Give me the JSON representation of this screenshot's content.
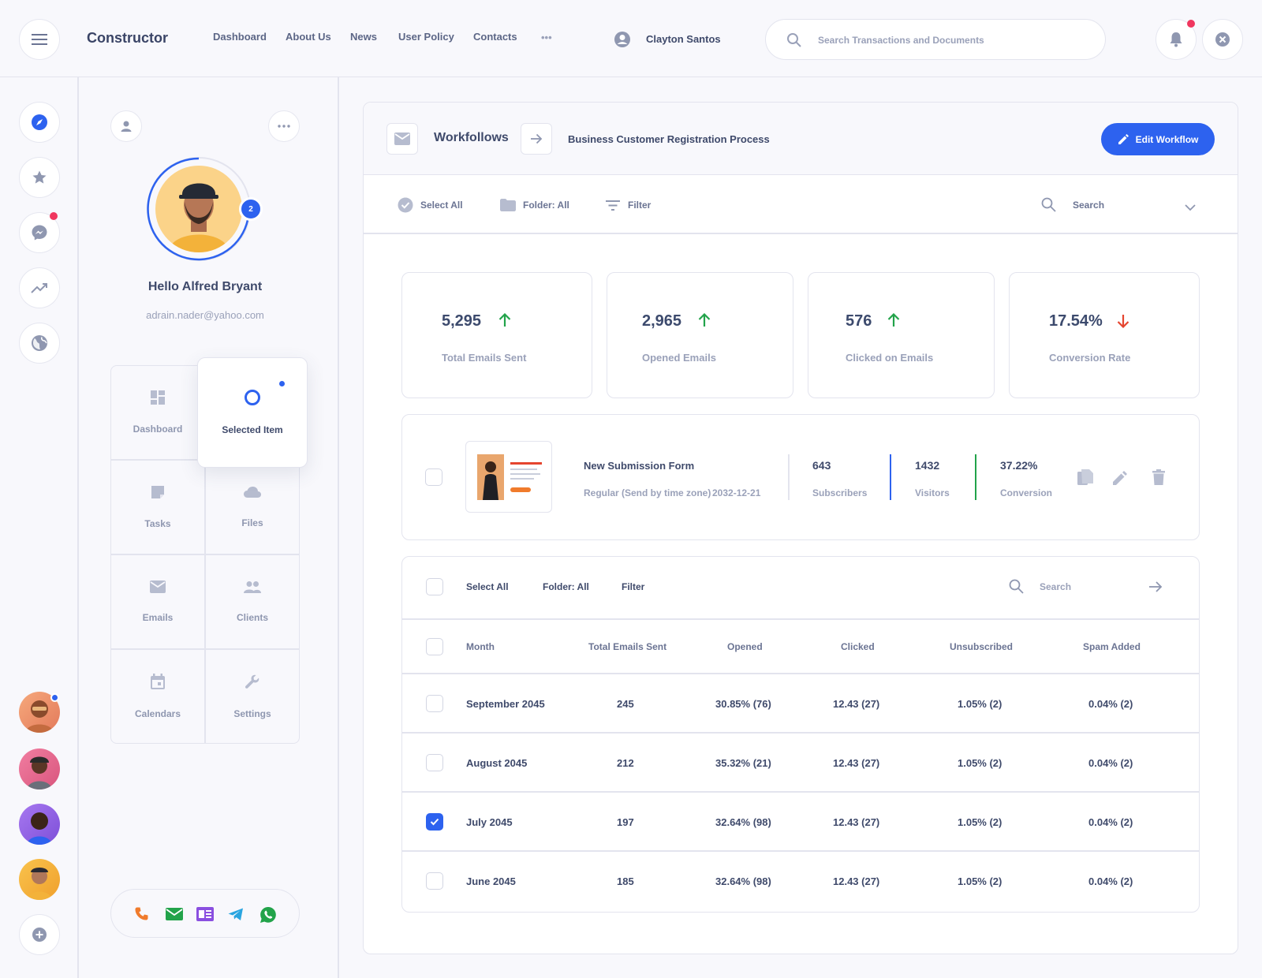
{
  "topbar": {
    "brand": "Constructor",
    "nav": [
      "Dashboard",
      "About Us",
      "News",
      "User Policy",
      "Contacts"
    ],
    "more": "•••",
    "user_name": "Clayton Santos",
    "search_placeholder": "Search Transactions and Documents"
  },
  "profile": {
    "greeting": "Hello Alfred Bryant",
    "email": "adrain.nader@yahoo.com",
    "badge_count": "2"
  },
  "menu": {
    "dashboard": "Dashboard",
    "selected": "Selected Item",
    "tasks": "Tasks",
    "files": "Files",
    "emails": "Emails",
    "clients": "Clients",
    "calendars": "Calendars",
    "settings": "Settings"
  },
  "header": {
    "workflows": "Workfollows",
    "process": "Business Customer Registration Process",
    "edit_button": "Edit Workflow"
  },
  "toolbar": {
    "select_all": "Select All",
    "folder": "Folder: All",
    "filter": "Filter",
    "search": "Search"
  },
  "stats": [
    {
      "value": "5,295",
      "label": "Total Emails Sent",
      "trend": "up"
    },
    {
      "value": "2,965",
      "label": "Opened Emails",
      "trend": "up"
    },
    {
      "value": "576",
      "label": "Clicked on Emails",
      "trend": "up"
    },
    {
      "value": "17.54%",
      "label": "Conversion Rate",
      "trend": "down"
    }
  ],
  "submission": {
    "title": "New Submission Form",
    "subtitle": "Regular (Send by time zone)",
    "date": "2032-12-21",
    "subscribers_value": "643",
    "subscribers_label": "Subscribers",
    "visitors_value": "1432",
    "visitors_label": "Visitors",
    "conversion_value": "37.22%",
    "conversion_label": "Conversion"
  },
  "table": {
    "headers": [
      "Month",
      "Total Emails Sent",
      "Opened",
      "Clicked",
      "Unsubscribed",
      "Spam Added"
    ],
    "rows": [
      {
        "month": "September 2045",
        "sent": "245",
        "opened": "30.85% (76)",
        "clicked": "12.43 (27)",
        "unsub": "1.05% (2)",
        "spam": "0.04% (2)",
        "checked": false
      },
      {
        "month": "August 2045",
        "sent": "212",
        "opened": "35.32% (21)",
        "clicked": "12.43 (27)",
        "unsub": "1.05% (2)",
        "spam": "0.04% (2)",
        "checked": false
      },
      {
        "month": "July 2045",
        "sent": "197",
        "opened": "32.64% (98)",
        "clicked": "12.43 (27)",
        "unsub": "1.05% (2)",
        "spam": "0.04% (2)",
        "checked": true
      },
      {
        "month": "June 2045",
        "sent": "185",
        "opened": "32.64% (98)",
        "clicked": "12.43 (27)",
        "unsub": "1.05% (2)",
        "spam": "0.04% (2)",
        "checked": false
      }
    ]
  },
  "colors": {
    "accent": "#2d62ef",
    "up": "#22a34a",
    "down": "#e5452f",
    "notification": "#f0365e"
  }
}
